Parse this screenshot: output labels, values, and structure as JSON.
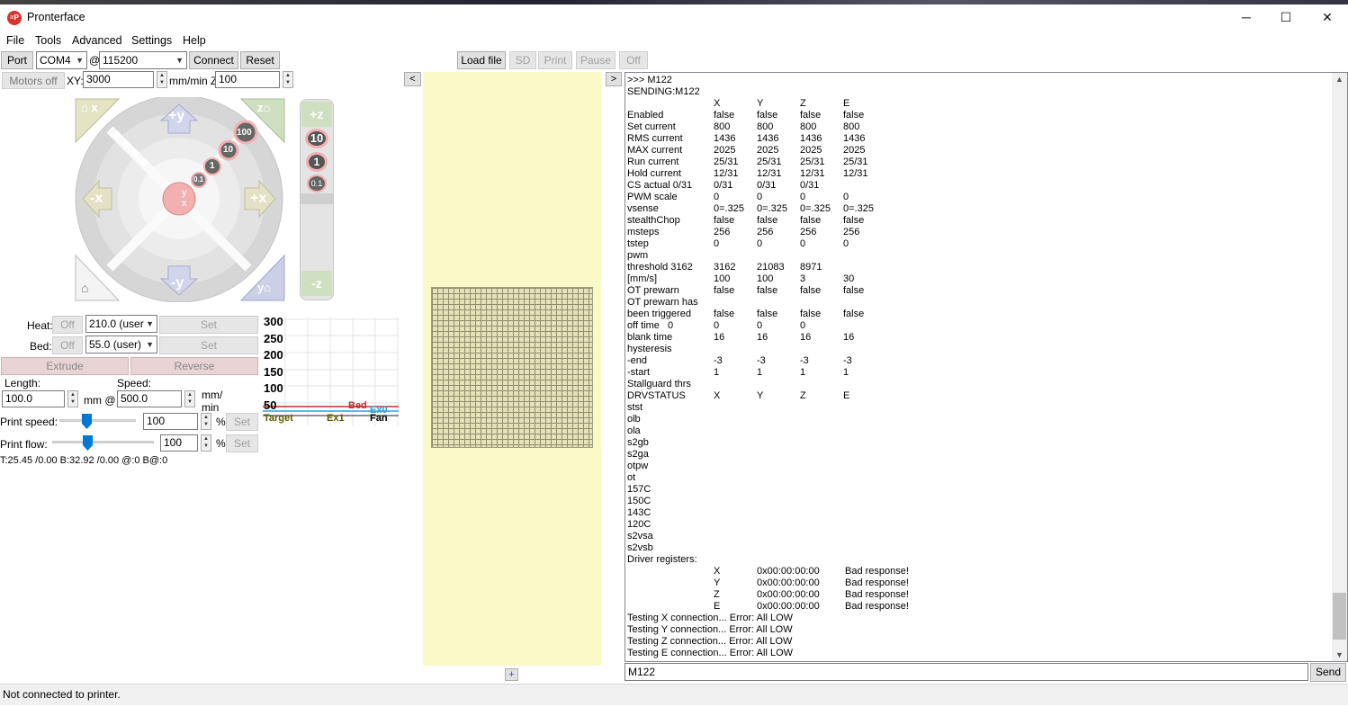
{
  "window": {
    "title": "Pronterface",
    "icon": "pronterface-logo",
    "min": "─",
    "max": "☐",
    "close": "✕"
  },
  "menu": [
    "File",
    "Tools",
    "Advanced",
    "Settings",
    "Help"
  ],
  "toolbar": {
    "port_label": "Port",
    "port_value": "COM4",
    "at": "@",
    "baud_value": "115200",
    "connect": "Connect",
    "reset": "Reset",
    "load_file": "Load file",
    "sd": "SD",
    "print": "Print",
    "pause": "Pause",
    "off": "Off"
  },
  "motion": {
    "motors_off": "Motors off",
    "xy_label": "XY:",
    "xy_value": "3000",
    "mm_min_z": "mm/min Z:",
    "z_value": "100",
    "jog_labels": {
      "plus_y": "+y",
      "minus_y": "-y",
      "plus_x": "+x",
      "minus_x": "-x",
      "home_x": "x",
      "home_y": "y",
      "home_z": "z",
      "center_y": "y",
      "center_x": "x"
    },
    "steps": [
      "100",
      "10",
      "1",
      "0.1"
    ],
    "z_labels": {
      "plus_z": "+z",
      "minus_z": "-z"
    },
    "z_steps": [
      "10",
      "1",
      "0.1"
    ]
  },
  "temps": {
    "heat_label": "Heat:",
    "heat_off": "Off",
    "heat_value": "210.0 (user",
    "heat_set": "Set",
    "bed_label": "Bed:",
    "bed_off": "Off",
    "bed_value": "55.0 (user)",
    "bed_set": "Set"
  },
  "extrude": {
    "extrude": "Extrude",
    "reverse": "Reverse",
    "length_label": "Length:",
    "length_value": "100.0",
    "mm_at": "mm @",
    "speed_label": "Speed:",
    "speed_value": "500.0",
    "mm_min": "mm/\nmin"
  },
  "print_speed": {
    "label": "Print speed:",
    "value": "100",
    "pct": "%",
    "set": "Set",
    "level": 100
  },
  "print_flow": {
    "label": "Print flow:",
    "value": "100",
    "pct": "%",
    "set": "Set",
    "level": 100
  },
  "temp_readout": "T:25.45 /0.00 B:32.92 /0.00 @:0 B@:0",
  "graph": {
    "yticks": [
      "300",
      "250",
      "200",
      "150",
      "100",
      "50"
    ],
    "legend": [
      "Target",
      "Ex1",
      "Fan"
    ],
    "series_labels": [
      "Bed",
      "Ex0"
    ],
    "colors": {
      "bed": "#c03030",
      "ex0": "#2aa0e0",
      "target": "#606000"
    }
  },
  "preview": {
    "collapse_left": "<",
    "collapse_right": ">",
    "add": "+"
  },
  "console": {
    "lines": [
      [
        ">>> M122"
      ],
      [
        "SENDING:M122"
      ],
      [
        "",
        "X",
        "Y",
        "Z",
        "E"
      ],
      [
        "Enabled",
        "false",
        "false",
        "false",
        "false"
      ],
      [
        "Set current",
        "800",
        "800",
        "800",
        "800"
      ],
      [
        "RMS current",
        "1436",
        "1436",
        "1436",
        "1436"
      ],
      [
        "MAX current",
        "2025",
        "2025",
        "2025",
        "2025"
      ],
      [
        "Run current",
        "25/31",
        "25/31",
        "25/31",
        "25/31"
      ],
      [
        "Hold current",
        "12/31",
        "12/31",
        "12/31",
        "12/31"
      ],
      [
        "CS actual 0/31",
        "0/31",
        "0/31",
        "0/31"
      ],
      [
        "PWM scale",
        "0",
        "0",
        "0",
        "0"
      ],
      [
        "vsense",
        "0=.325",
        "0=.325",
        "0=.325",
        "0=.325"
      ],
      [
        "stealthChop",
        "false",
        "false",
        "false",
        "false"
      ],
      [
        "msteps",
        "256",
        "256",
        "256",
        "256"
      ],
      [
        "tstep",
        "0",
        "0",
        "0",
        "0"
      ],
      [
        "pwm"
      ],
      [
        "threshold 3162",
        "3162",
        "21083",
        "8971"
      ],
      [
        "[mm/s]",
        "100",
        "100",
        "3",
        "30"
      ],
      [
        "OT prewarn",
        "false",
        "false",
        "false",
        "false"
      ],
      [
        "OT prewarn has"
      ],
      [
        "been triggered",
        "false",
        "false",
        "false",
        "false"
      ],
      [
        "off time   0",
        "0",
        "0",
        "0"
      ],
      [
        "blank time",
        "16",
        "16",
        "16",
        "16"
      ],
      [
        "hysteresis"
      ],
      [
        "-end",
        "-3",
        "-3",
        "-3",
        "-3"
      ],
      [
        "-start",
        "1",
        "1",
        "1",
        "1"
      ],
      [
        "Stallguard thrs"
      ],
      [
        "DRVSTATUS",
        "X",
        "Y",
        "Z",
        "E"
      ],
      [
        "stst"
      ],
      [
        "olb"
      ],
      [
        "ola"
      ],
      [
        "s2gb"
      ],
      [
        "s2ga"
      ],
      [
        "otpw"
      ],
      [
        "ot"
      ],
      [
        "157C"
      ],
      [
        "150C"
      ],
      [
        "143C"
      ],
      [
        "120C"
      ],
      [
        "s2vsa"
      ],
      [
        "s2vsb"
      ],
      [
        "Driver registers:"
      ]
    ],
    "registers": [
      [
        "X",
        "0x00:00:00:00",
        "Bad response!"
      ],
      [
        "Y",
        "0x00:00:00:00",
        "Bad response!"
      ],
      [
        "Z",
        "0x00:00:00:00",
        "Bad response!"
      ],
      [
        "E",
        "0x00:00:00:00",
        "Bad response!"
      ]
    ],
    "tests": [
      "Testing X connection... Error: All LOW",
      "Testing Y connection... Error: All LOW",
      "Testing Z connection... Error: All LOW",
      "Testing E connection... Error: All LOW"
    ],
    "command_value": "M122",
    "send": "Send"
  },
  "status": "Not connected to printer."
}
